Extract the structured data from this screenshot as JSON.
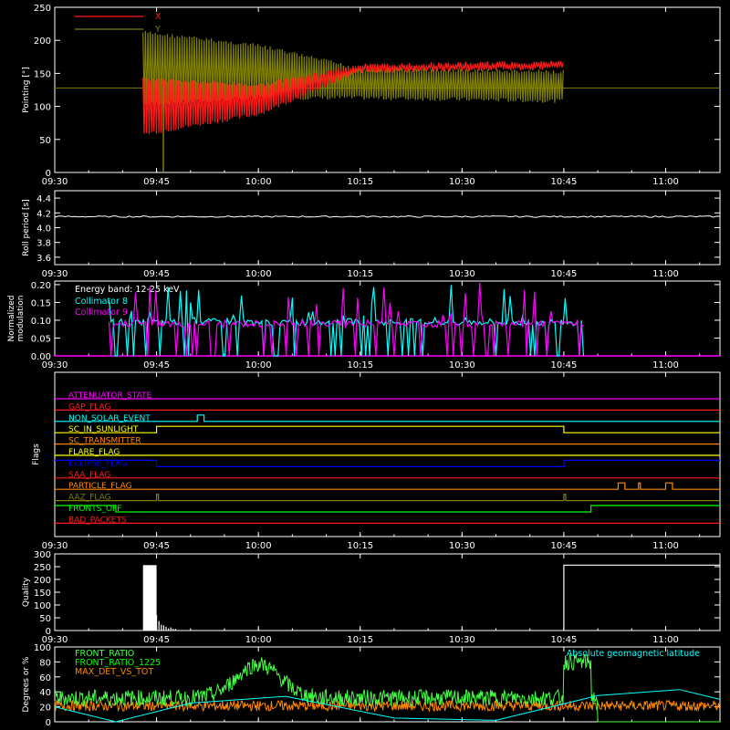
{
  "time_ticks": [
    "09:30",
    "09:45",
    "10:00",
    "10:15",
    "10:30",
    "10:45",
    "11:00"
  ],
  "colors": {
    "bg": "#000000",
    "axis": "#ffffff",
    "red": "#ff1a1a",
    "olive": "#808000",
    "cyan": "#00ffff",
    "magenta": "#ff00ff",
    "yellow": "#ffff00",
    "orange": "#ff8800",
    "blue": "#0000ff",
    "green": "#00ff00",
    "lightgreen": "#44ff44",
    "white": "#ffffff",
    "mutedcyan": "#55cccc"
  },
  "chart_data": [
    {
      "id": "pointing",
      "type": "line",
      "ylabel": "Pointing [°]",
      "y_ticks": [
        "0",
        "50",
        "100",
        "150",
        "200",
        "250"
      ],
      "ylim": [
        0,
        250
      ],
      "x_range": [
        "09:30",
        "11:08"
      ],
      "legend": [
        {
          "name": "X",
          "color": "#ff1a1a"
        },
        {
          "name": "Y",
          "color": "#808000"
        }
      ],
      "reference_level": 128,
      "data_start": "09:43",
      "data_end": "10:45",
      "series": [
        {
          "name": "X",
          "color": "#ff1a1a",
          "envelope": [
            {
              "t": "09:43",
              "lo": 55,
              "hi": 145
            },
            {
              "t": "10:00",
              "lo": 85,
              "hi": 135
            },
            {
              "t": "10:15",
              "lo": 150,
              "hi": 165
            },
            {
              "t": "10:45",
              "lo": 155,
              "hi": 170
            }
          ]
        },
        {
          "name": "Y",
          "color": "#808000",
          "envelope": [
            {
              "t": "09:43",
              "lo": 100,
              "hi": 215
            },
            {
              "t": "10:00",
              "lo": 110,
              "hi": 195
            },
            {
              "t": "10:15",
              "lo": 110,
              "hi": 160
            },
            {
              "t": "10:45",
              "lo": 105,
              "hi": 155
            }
          ]
        }
      ]
    },
    {
      "id": "roll",
      "type": "line",
      "ylabel": "Roll period [s]",
      "y_ticks": [
        "3.6",
        "3.8",
        "4.0",
        "4.2",
        "4.4"
      ],
      "ylim": [
        3.5,
        4.5
      ],
      "x_range": [
        "09:30",
        "11:08"
      ],
      "series": [
        {
          "name": "",
          "color": "#ffffff",
          "value": 4.15,
          "start": "09:30",
          "end": "11:08"
        }
      ]
    },
    {
      "id": "modulation",
      "type": "line",
      "ylabel": "Normalized modulation",
      "y_ticks": [
        "0.00",
        "0.05",
        "0.10",
        "0.15",
        "0.20"
      ],
      "ylim": [
        0,
        0.21
      ],
      "x_range": [
        "09:30",
        "11:08"
      ],
      "annotation": "Energy band: 12-25 keV",
      "legend": [
        {
          "name": "Collimator 8",
          "color": "#00ffff"
        },
        {
          "name": "Collimator 9",
          "color": "#ff00ff"
        }
      ],
      "active_start": "09:38",
      "active_end": "10:48",
      "series": [
        {
          "name": "Collimator 8",
          "color": "#00ffff",
          "typical": 0.095,
          "max": 0.2
        },
        {
          "name": "Collimator 9",
          "color": "#ff00ff",
          "typical": 0.09,
          "max": 0.21
        }
      ]
    },
    {
      "id": "flags",
      "type": "line",
      "ylabel": "Flags",
      "x_range": [
        "09:30",
        "11:08"
      ],
      "series": [
        {
          "name": "ATTENUATOR_STATE",
          "color": "#ff00ff",
          "high_intervals": []
        },
        {
          "name": "GAP_FLAG",
          "color": "#ff1a1a",
          "high_intervals": []
        },
        {
          "name": "NON_SOLAR_EVENT",
          "color": "#00ffff",
          "high_intervals": [
            [
              "09:51",
              "09:52"
            ]
          ]
        },
        {
          "name": "SC_IN_SUNLIGHT",
          "color": "#ffff00",
          "high_intervals": [
            [
              "09:45",
              "10:45"
            ]
          ]
        },
        {
          "name": "SC_TRANSMITTER",
          "color": "#ff8800",
          "high_intervals": []
        },
        {
          "name": "FLARE_FLAG",
          "color": "#ffff00",
          "high_intervals": []
        },
        {
          "name": "ECLIPSE_FLAG",
          "color": "#0000ff",
          "high_intervals": [
            [
              "09:30",
              "09:45"
            ],
            [
              "10:45",
              "11:08"
            ]
          ]
        },
        {
          "name": "SAA_FLAG",
          "color": "#ff1a1a",
          "high_intervals": []
        },
        {
          "name": "PARTICLE_FLAG",
          "color": "#ff8800",
          "high_intervals": [
            [
              "10:53",
              "10:54"
            ],
            [
              "10:56",
              "10:56"
            ],
            [
              "11:00",
              "11:01"
            ]
          ]
        },
        {
          "name": "AAZ_FLAG",
          "color": "#808000",
          "high_intervals": [
            [
              "09:45",
              "09:45"
            ],
            [
              "10:45",
              "10:45"
            ]
          ]
        },
        {
          "name": "FRONTS_OFF",
          "color": "#00ff00",
          "high_intervals": [
            [
              "09:30",
              "09:39"
            ],
            [
              "10:49",
              "11:08"
            ]
          ]
        },
        {
          "name": "BAD_PACKETS",
          "color": "#ff1a1a",
          "high_intervals": []
        }
      ]
    },
    {
      "id": "quality",
      "type": "bar",
      "ylabel": "Quality",
      "y_ticks": [
        "0",
        "50",
        "100",
        "150",
        "200",
        "250",
        "300"
      ],
      "ylim": [
        0,
        300
      ],
      "x_range": [
        "09:30",
        "11:08"
      ],
      "series": [
        {
          "name": "",
          "color": "#ffffff",
          "segments": [
            {
              "start": "09:43",
              "end": "09:45",
              "value": 256
            },
            {
              "start": "09:45",
              "end": "09:48",
              "value": 60,
              "decaying": true
            },
            {
              "start": "10:45",
              "end": "11:08",
              "value": 256
            }
          ]
        }
      ]
    },
    {
      "id": "ratios",
      "type": "line",
      "ylabel": "Degrees or %",
      "y_ticks": [
        "0",
        "20",
        "40",
        "60",
        "80",
        "100"
      ],
      "ylim": [
        0,
        100
      ],
      "x_range": [
        "09:30",
        "11:08"
      ],
      "legend": [
        {
          "name": "FRONT_RATIO",
          "color": "#44ff44"
        },
        {
          "name": "FRONT_RATIO_1225",
          "color": "#00ff00"
        },
        {
          "name": "MAX_DET_VS_TOT",
          "color": "#ff8800"
        },
        {
          "name": "Absolute geomagnetic latitude",
          "color": "#00ffff"
        }
      ],
      "series": [
        {
          "name": "FRONT_RATIO",
          "color": "#44ff44",
          "baseline": 32,
          "peaks": [
            {
              "t": "10:00",
              "v": 85
            },
            {
              "t": "10:48",
              "v": 80
            }
          ]
        },
        {
          "name": "FRONT_RATIO_1225",
          "color": "#00ff00",
          "baseline": 25
        },
        {
          "name": "MAX_DET_VS_TOT",
          "color": "#ff8800",
          "baseline": 20
        },
        {
          "name": "Absolute geomagnetic latitude",
          "color": "#00ffff",
          "points": [
            {
              "t": "09:30",
              "v": 20
            },
            {
              "t": "09:39",
              "v": 0
            },
            {
              "t": "09:50",
              "v": 25
            },
            {
              "t": "10:04",
              "v": 34
            },
            {
              "t": "10:20",
              "v": 5
            },
            {
              "t": "10:35",
              "v": 2
            },
            {
              "t": "10:50",
              "v": 35
            },
            {
              "t": "11:02",
              "v": 43
            },
            {
              "t": "11:08",
              "v": 30
            }
          ]
        }
      ]
    }
  ]
}
